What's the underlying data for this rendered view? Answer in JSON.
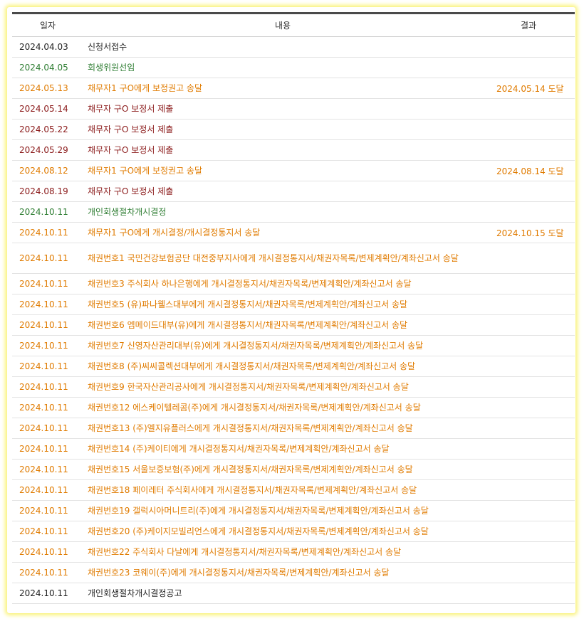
{
  "headers": {
    "date": "일자",
    "content": "내용",
    "result": "결과"
  },
  "colors": {
    "black": "#222222",
    "green": "#2e7d32",
    "orange": "#e07b00",
    "red": "#8b1a1a"
  },
  "rows": [
    {
      "date": "2024.04.03",
      "content": "신청서접수",
      "result": "",
      "color": "black"
    },
    {
      "date": "2024.04.05",
      "content": "회생위원선임",
      "result": "",
      "color": "green"
    },
    {
      "date": "2024.05.13",
      "content": "채무자1 구O에게 보정권고 송달",
      "result": "2024.05.14 도달",
      "color": "orange"
    },
    {
      "date": "2024.05.14",
      "content": "채무자 구O 보정서 제출",
      "result": "",
      "color": "red"
    },
    {
      "date": "2024.05.22",
      "content": "채무자 구O 보정서 제출",
      "result": "",
      "color": "red"
    },
    {
      "date": "2024.05.29",
      "content": "채무자 구O 보정서 제출",
      "result": "",
      "color": "red"
    },
    {
      "date": "2024.08.12",
      "content": "채무자1 구O에게 보정권고 송달",
      "result": "2024.08.14 도달",
      "color": "orange"
    },
    {
      "date": "2024.08.19",
      "content": "채무자 구O 보정서 제출",
      "result": "",
      "color": "red"
    },
    {
      "date": "2024.10.11",
      "content": "개인회생절차개시결정",
      "result": "",
      "color": "green"
    },
    {
      "date": "2024.10.11",
      "content": "채무자1 구O에게 개시결정/개시결정통지서 송달",
      "result": "2024.10.15 도달",
      "color": "orange"
    },
    {
      "date": "2024.10.11",
      "content": "채권번호1 국민건강보험공단 대전중부지사에게 개시결정통지서/채권자목록/변제계획안/계좌신고서 송달",
      "result": "",
      "color": "orange",
      "tall": true
    },
    {
      "date": "2024.10.11",
      "content": "채권번호3 주식회사 하나은행에게 개시결정통지서/채권자목록/변제계획안/계좌신고서 송달",
      "result": "",
      "color": "orange"
    },
    {
      "date": "2024.10.11",
      "content": "채권번호5 (유)파나웰스대부에게 개시결정통지서/채권자목록/변제계획안/계좌신고서 송달",
      "result": "",
      "color": "orange"
    },
    {
      "date": "2024.10.11",
      "content": "채권번호6 엠메이드대부(유)에게 개시결정통지서/채권자목록/변제계획안/계좌신고서 송달",
      "result": "",
      "color": "orange"
    },
    {
      "date": "2024.10.11",
      "content": "채권번호7 신영자산관리대부(유)에게 개시결정통지서/채권자목록/변제계획안/계좌신고서 송달",
      "result": "",
      "color": "orange"
    },
    {
      "date": "2024.10.11",
      "content": "채권번호8 (주)씨씨콜렉션대부에게 개시결정통지서/채권자목록/변제계획안/계좌신고서 송달",
      "result": "",
      "color": "orange"
    },
    {
      "date": "2024.10.11",
      "content": "채권번호9 한국자산관리공사에게 개시결정통지서/채권자목록/변제계획안/계좌신고서 송달",
      "result": "",
      "color": "orange"
    },
    {
      "date": "2024.10.11",
      "content": "채권번호12 에스케이텔레콤(주)에게 개시결정통지서/채권자목록/변제계획안/계좌신고서 송달",
      "result": "",
      "color": "orange"
    },
    {
      "date": "2024.10.11",
      "content": "채권번호13 (주)엘지유플러스에게 개시결정통지서/채권자목록/변제계획안/계좌신고서 송달",
      "result": "",
      "color": "orange"
    },
    {
      "date": "2024.10.11",
      "content": "채권번호14 (주)케이티에게 개시결정통지서/채권자목록/변제계획안/계좌신고서 송달",
      "result": "",
      "color": "orange"
    },
    {
      "date": "2024.10.11",
      "content": "채권번호15 서울보증보험(주)에게 개시결정통지서/채권자목록/변제계획안/계좌신고서 송달",
      "result": "",
      "color": "orange"
    },
    {
      "date": "2024.10.11",
      "content": "채권번호18 페이레터 주식회사에게 개시결정통지서/채권자목록/변제계획안/계좌신고서 송달",
      "result": "",
      "color": "orange"
    },
    {
      "date": "2024.10.11",
      "content": "채권번호19 갤럭시아머니트리(주)에게 개시결정통지서/채권자목록/변제계획안/계좌신고서 송달",
      "result": "",
      "color": "orange"
    },
    {
      "date": "2024.10.11",
      "content": "채권번호20 (주)케이지모빌리언스에게 개시결정통지서/채권자목록/변제계획안/계좌신고서 송달",
      "result": "",
      "color": "orange"
    },
    {
      "date": "2024.10.11",
      "content": "채권번호22 주식회사 다날에게 개시결정통지서/채권자목록/변제계획안/계좌신고서 송달",
      "result": "",
      "color": "orange"
    },
    {
      "date": "2024.10.11",
      "content": "채권번호23 코웨이(주)에게 개시결정통지서/채권자목록/변제계획안/계좌신고서 송달",
      "result": "",
      "color": "orange"
    },
    {
      "date": "2024.10.11",
      "content": "개인회생절차개시결정공고",
      "result": "",
      "color": "black"
    }
  ]
}
